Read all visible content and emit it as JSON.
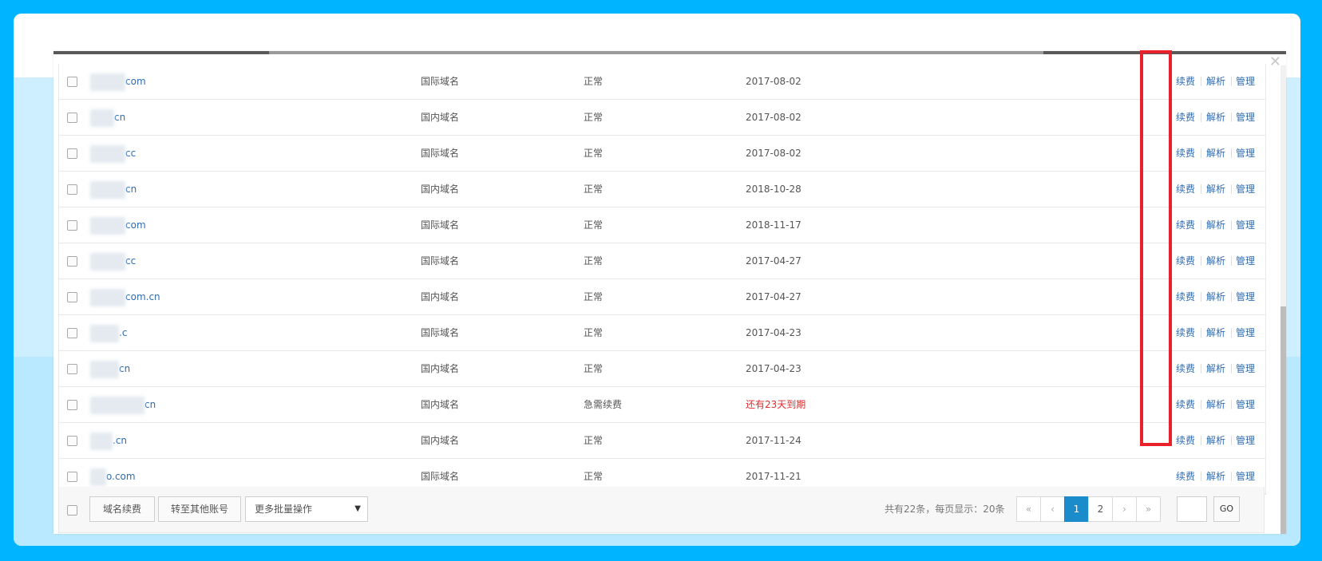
{
  "dialog": {
    "close_glyph": "✕"
  },
  "rows": [
    {
      "domain_suffix": "com",
      "type": "国际域名",
      "status": "正常",
      "date": "2017-08-02",
      "warn": false
    },
    {
      "domain_suffix": "cn",
      "type": "国内域名",
      "status": "正常",
      "date": "2017-08-02",
      "warn": false
    },
    {
      "domain_suffix": "cc",
      "type": "国际域名",
      "status": "正常",
      "date": "2017-08-02",
      "warn": false
    },
    {
      "domain_suffix": "cn",
      "type": "国内域名",
      "status": "正常",
      "date": "2018-10-28",
      "warn": false
    },
    {
      "domain_suffix": "com",
      "type": "国际域名",
      "status": "正常",
      "date": "2018-11-17",
      "warn": false
    },
    {
      "domain_suffix": "cc",
      "type": "国际域名",
      "status": "正常",
      "date": "2017-04-27",
      "warn": false
    },
    {
      "domain_suffix": "com.cn",
      "type": "国内域名",
      "status": "正常",
      "date": "2017-04-27",
      "warn": false
    },
    {
      "domain_suffix": ".c",
      "type": "国际域名",
      "status": "正常",
      "date": "2017-04-23",
      "warn": false
    },
    {
      "domain_suffix": "cn",
      "type": "国内域名",
      "status": "正常",
      "date": "2017-04-23",
      "warn": false
    },
    {
      "domain_suffix": "cn",
      "type": "国内域名",
      "status": "急需续费",
      "date": "还有23天到期",
      "warn": true
    },
    {
      "domain_suffix": ".cn",
      "type": "国内域名",
      "status": "正常",
      "date": "2017-11-24",
      "warn": false
    },
    {
      "domain_suffix": "o.com",
      "type": "国际域名",
      "status": "正常",
      "date": "2017-11-21",
      "warn": false
    }
  ],
  "actions": {
    "renew": "续费",
    "resolve": "解析",
    "manage": "管理"
  },
  "footer": {
    "renew_button": "域名续费",
    "transfer_button": "转至其他账号",
    "batch_select": "更多批量操作",
    "summary": "共有22条，每页显示：20条",
    "pager": [
      "«",
      "‹",
      "1",
      "2",
      "›",
      "»"
    ],
    "active_page": "1",
    "go_button": "GO"
  },
  "colors": {
    "link": "#2e6cb3",
    "warning": "#e32b2b",
    "highlight": "#e8212b",
    "active_page": "#1a8ccb"
  }
}
